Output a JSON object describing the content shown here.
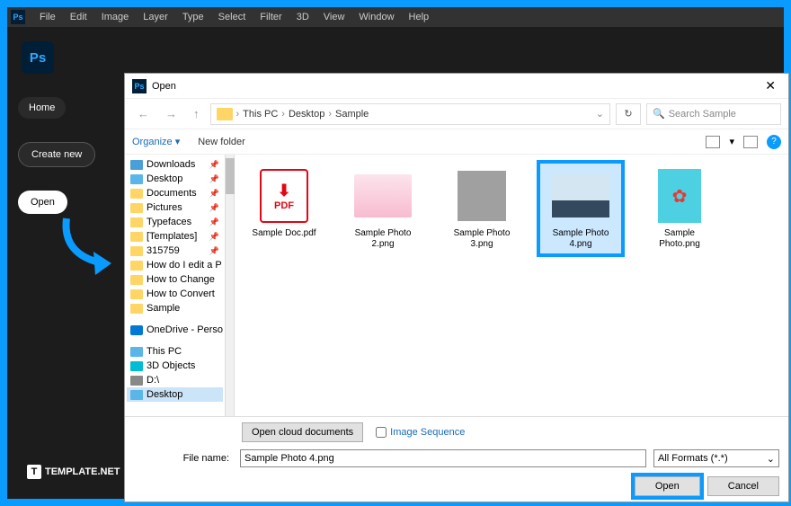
{
  "menu": [
    "File",
    "Edit",
    "Image",
    "Layer",
    "Type",
    "Select",
    "Filter",
    "3D",
    "View",
    "Window",
    "Help"
  ],
  "ps_label": "Ps",
  "sidebar": {
    "home": "Home",
    "create": "Create new",
    "open": "Open"
  },
  "dialog": {
    "title": "Open",
    "breadcrumb": [
      "This PC",
      "Desktop",
      "Sample"
    ],
    "refresh_icon": "↻",
    "search_placeholder": "Search Sample",
    "organize": "Organize ▾",
    "new_folder": "New folder",
    "tree": [
      {
        "icon": "dl",
        "label": "Downloads",
        "pin": true
      },
      {
        "icon": "pc",
        "label": "Desktop",
        "pin": true
      },
      {
        "icon": "fo",
        "label": "Documents",
        "pin": true
      },
      {
        "icon": "fo",
        "label": "Pictures",
        "pin": true
      },
      {
        "icon": "fo",
        "label": "Typefaces",
        "pin": true
      },
      {
        "icon": "fo",
        "label": "[Templates]",
        "pin": true
      },
      {
        "icon": "fo",
        "label": "315759",
        "pin": true
      },
      {
        "icon": "fo",
        "label": "How do I edit a P"
      },
      {
        "icon": "fo",
        "label": "How to Change"
      },
      {
        "icon": "fo",
        "label": "How to Convert"
      },
      {
        "icon": "fo",
        "label": "Sample"
      },
      {
        "icon": "od",
        "label": "OneDrive - Person",
        "section": true
      },
      {
        "icon": "pc",
        "label": "This PC",
        "section": true
      },
      {
        "icon": "d3",
        "label": "3D Objects"
      },
      {
        "icon": "dr",
        "label": "D:\\"
      },
      {
        "icon": "pc",
        "label": "Desktop",
        "sel": true
      }
    ],
    "files": [
      {
        "name": "Sample Doc.pdf",
        "type": "pdf"
      },
      {
        "name": "Sample Photo 2.png",
        "type": "photo2"
      },
      {
        "name": "Sample Photo 3.png",
        "type": "blank"
      },
      {
        "name": "Sample Photo 4.png",
        "type": "mountain",
        "selected": true
      },
      {
        "name": "Sample Photo.png",
        "type": "flower"
      }
    ],
    "cloud_btn": "Open cloud documents",
    "image_seq": "Image Sequence",
    "filename_label": "File name:",
    "filename_value": "Sample Photo 4.png",
    "format": "All Formats (*.*)",
    "open_btn": "Open",
    "cancel_btn": "Cancel"
  },
  "watermark": "TEMPLATE.NET"
}
